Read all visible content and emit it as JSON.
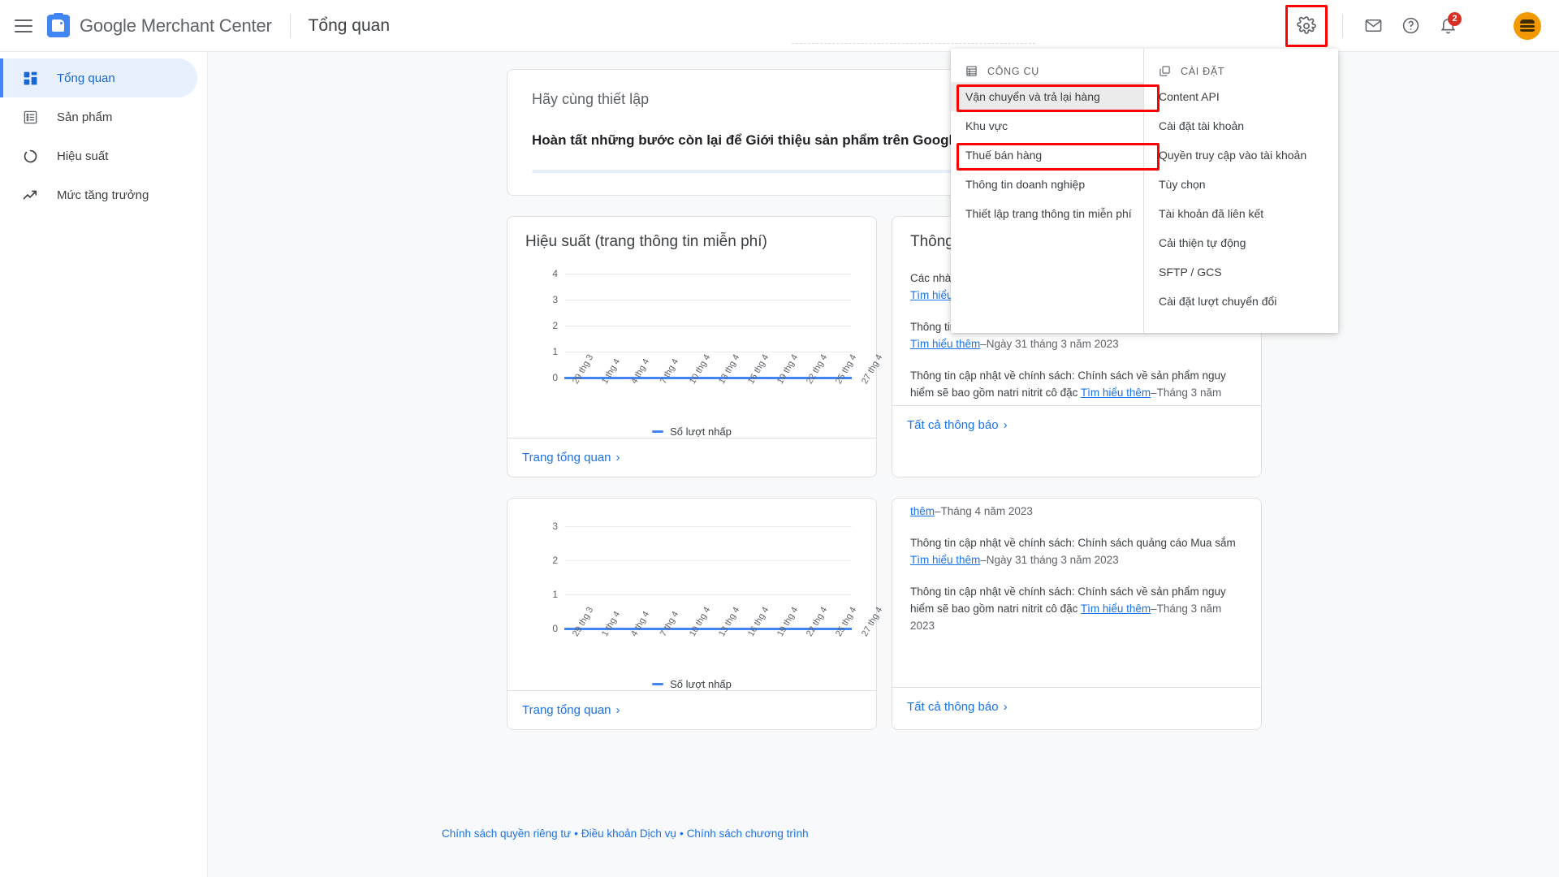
{
  "header": {
    "menu_icon": "hamburger-icon",
    "brand_google": "Google",
    "brand_product": "Merchant Center",
    "page_title": "Tổng quan",
    "icons": {
      "settings": "gear-icon",
      "mail": "envelope-icon",
      "help": "question-mark-icon",
      "notifications": "bell-icon",
      "avatar": "avatar-burger-icon"
    },
    "notification_count": "2"
  },
  "sidebar": {
    "items": [
      {
        "label": "Tổng quan",
        "icon": "dashboard-icon",
        "active": true
      },
      {
        "label": "Sản phẩm",
        "icon": "list-icon",
        "active": false
      },
      {
        "label": "Hiệu suất",
        "icon": "donut-icon",
        "active": false
      },
      {
        "label": "Mức tăng trưởng",
        "icon": "trending-up-icon",
        "active": false
      }
    ]
  },
  "setup_card": {
    "subtitle": "Hãy cùng thiết lập",
    "title": "Hoàn tất những bước còn lại để Giới thiệu sản phẩm trên Google",
    "progress_percent": 0
  },
  "performance_card": {
    "title": "Hiệu suất (trang thông tin miễn phí)",
    "footer_link": "Trang tổng quan",
    "chevron": "›"
  },
  "performance_card_2": {
    "footer_link": "Trang tổng quan",
    "chevron": "›"
  },
  "notifications_card": {
    "title": "Thông báo",
    "footer_link": "Tất cả thông báo",
    "chevron": "›",
    "items": [
      {
        "text": "Các nhà quảng cáo hiện có thể thêm các mặt hàng vào chiến dịch ",
        "link": "Tìm hiểu thêm",
        "separator": "–",
        "date": "Tháng 4 năm 2023"
      },
      {
        "text": "Thông tin cập nhật về chính sách: Chính sách quảng cáo Mua sắm ",
        "link": "Tìm hiểu thêm",
        "separator": "–",
        "date": "Ngày 31 tháng 3 năm 2023"
      },
      {
        "text": "Thông tin cập nhật về chính sách: Chính sách về sản phẩm nguy hiểm sẽ bao gồm natri nitrit cô đặc ",
        "link": "Tìm hiểu thêm",
        "separator": "–",
        "date": "Tháng 3 năm 2023"
      }
    ]
  },
  "notifications_card_2": {
    "footer_link": "Tất cả thông báo",
    "chevron": "›",
    "items": [
      {
        "text": "",
        "link": "thêm",
        "separator": "–",
        "date": "Tháng 4 năm 2023"
      },
      {
        "text": "Thông tin cập nhật về chính sách: Chính sách quảng cáo Mua sắm ",
        "link": "Tìm hiểu thêm",
        "separator": "–",
        "date": "Ngày 31 tháng 3 năm 2023"
      },
      {
        "text": "Thông tin cập nhật về chính sách: Chính sách về sản phẩm nguy hiểm sẽ bao gồm natri nitrit cô đặc ",
        "link": "Tìm hiểu thêm",
        "separator": "–",
        "date": "Tháng 3 năm 2023"
      }
    ]
  },
  "dropdown": {
    "tools": {
      "header": "CÔNG CỤ",
      "header_icon": "grid-tools-icon",
      "items": [
        {
          "label": "Vận chuyển và trả lại hàng",
          "hovered": true,
          "highlighted": true
        },
        {
          "label": "Khu vực",
          "hovered": false,
          "highlighted": false
        },
        {
          "label": "Thuế bán hàng",
          "hovered": false,
          "highlighted": true
        },
        {
          "label": "Thông tin doanh nghiệp",
          "hovered": false,
          "highlighted": false
        },
        {
          "label": "Thiết lập trang thông tin miễn phí",
          "hovered": false,
          "highlighted": false
        }
      ]
    },
    "settings": {
      "header": "CÀI ĐẶT",
      "header_icon": "copy-layers-icon",
      "items": [
        {
          "label": "Content API"
        },
        {
          "label": "Cài đặt tài khoản"
        },
        {
          "label": "Quyền truy cập vào tài khoản"
        },
        {
          "label": "Tùy chọn"
        },
        {
          "label": "Tài khoản đã liên kết"
        },
        {
          "label": "Cải thiện tự động"
        },
        {
          "label": "SFTP / GCS"
        },
        {
          "label": "Cài đặt lượt chuyển đổi"
        }
      ]
    }
  },
  "footer": {
    "privacy": "Chính sách quyền riêng tư",
    "terms": "Điều khoản Dịch vụ",
    "program": "Chính sách chương trình",
    "separator": "•"
  },
  "colors": {
    "accent": "#4285f4",
    "link": "#1a73e8",
    "highlight_red": "#ff0000",
    "badge_red": "#d93025",
    "avatar_orange": "#f29900",
    "nav_active_bg": "#e8f0fe",
    "page_bg": "#f8f9fa"
  },
  "chart_data": [
    {
      "type": "line",
      "title": "Hiệu suất (trang thông tin miễn phí)",
      "xlabel": "",
      "ylabel": "",
      "ylim": [
        0,
        4
      ],
      "yticks": [
        0,
        1,
        2,
        3,
        4
      ],
      "grid": true,
      "legend_position": "bottom",
      "x": [
        "29 thg 3",
        "1 thg 4",
        "4 thg 4",
        "7 thg 4",
        "10 thg 4",
        "13 thg 4",
        "16 thg 4",
        "19 thg 4",
        "22 thg 4",
        "25 thg 4",
        "27 thg 4"
      ],
      "series": [
        {
          "name": "Số lượt nhấp",
          "values": [
            0,
            0,
            0,
            0,
            0,
            0,
            0,
            0,
            0,
            0,
            0
          ],
          "color": "#4285f4"
        }
      ]
    },
    {
      "type": "line",
      "title": "",
      "xlabel": "",
      "ylabel": "",
      "ylim": [
        0,
        3
      ],
      "yticks": [
        0,
        1,
        2,
        3
      ],
      "grid": true,
      "legend_position": "bottom",
      "x": [
        "29 thg 3",
        "1 thg 4",
        "4 thg 4",
        "7 thg 4",
        "10 thg 4",
        "13 thg 4",
        "16 thg 4",
        "19 thg 4",
        "22 thg 4",
        "25 thg 4",
        "27 thg 4"
      ],
      "series": [
        {
          "name": "Số lượt nhấp",
          "values": [
            0,
            0,
            0,
            0,
            0,
            0,
            0,
            0,
            0,
            0,
            0
          ],
          "color": "#4285f4"
        }
      ]
    }
  ]
}
